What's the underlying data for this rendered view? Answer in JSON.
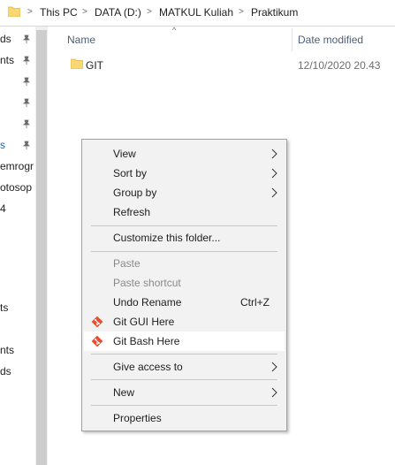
{
  "breadcrumb": {
    "items": [
      "This PC",
      "DATA (D:)",
      "MATKUL Kuliah",
      "Praktikum"
    ],
    "separator": ">"
  },
  "nav": {
    "items": [
      "ds",
      "nts",
      "s",
      "emrogr",
      "otosop",
      "4",
      "ts",
      "nts",
      "ds"
    ]
  },
  "file_list": {
    "headers": {
      "name": "Name",
      "date": "Date modified",
      "sort_arrow": "^"
    },
    "rows": [
      {
        "name": "GIT",
        "date": "12/10/2020 20.43"
      }
    ]
  },
  "context_menu": {
    "view": "View",
    "sort_by": "Sort by",
    "group_by": "Group by",
    "refresh": "Refresh",
    "customize": "Customize this folder...",
    "paste": "Paste",
    "paste_shortcut": "Paste shortcut",
    "undo_rename": "Undo Rename",
    "undo_shortcut": "Ctrl+Z",
    "git_gui": "Git GUI Here",
    "git_bash": "Git Bash Here",
    "give_access": "Give access to",
    "new": "New",
    "properties": "Properties"
  },
  "colors": {
    "folder": "#f8d775",
    "folder_dark": "#e3b341",
    "git_red": "#e84e31",
    "menu_bg": "#f2f2f2",
    "hover_bg": "#ffffff"
  }
}
